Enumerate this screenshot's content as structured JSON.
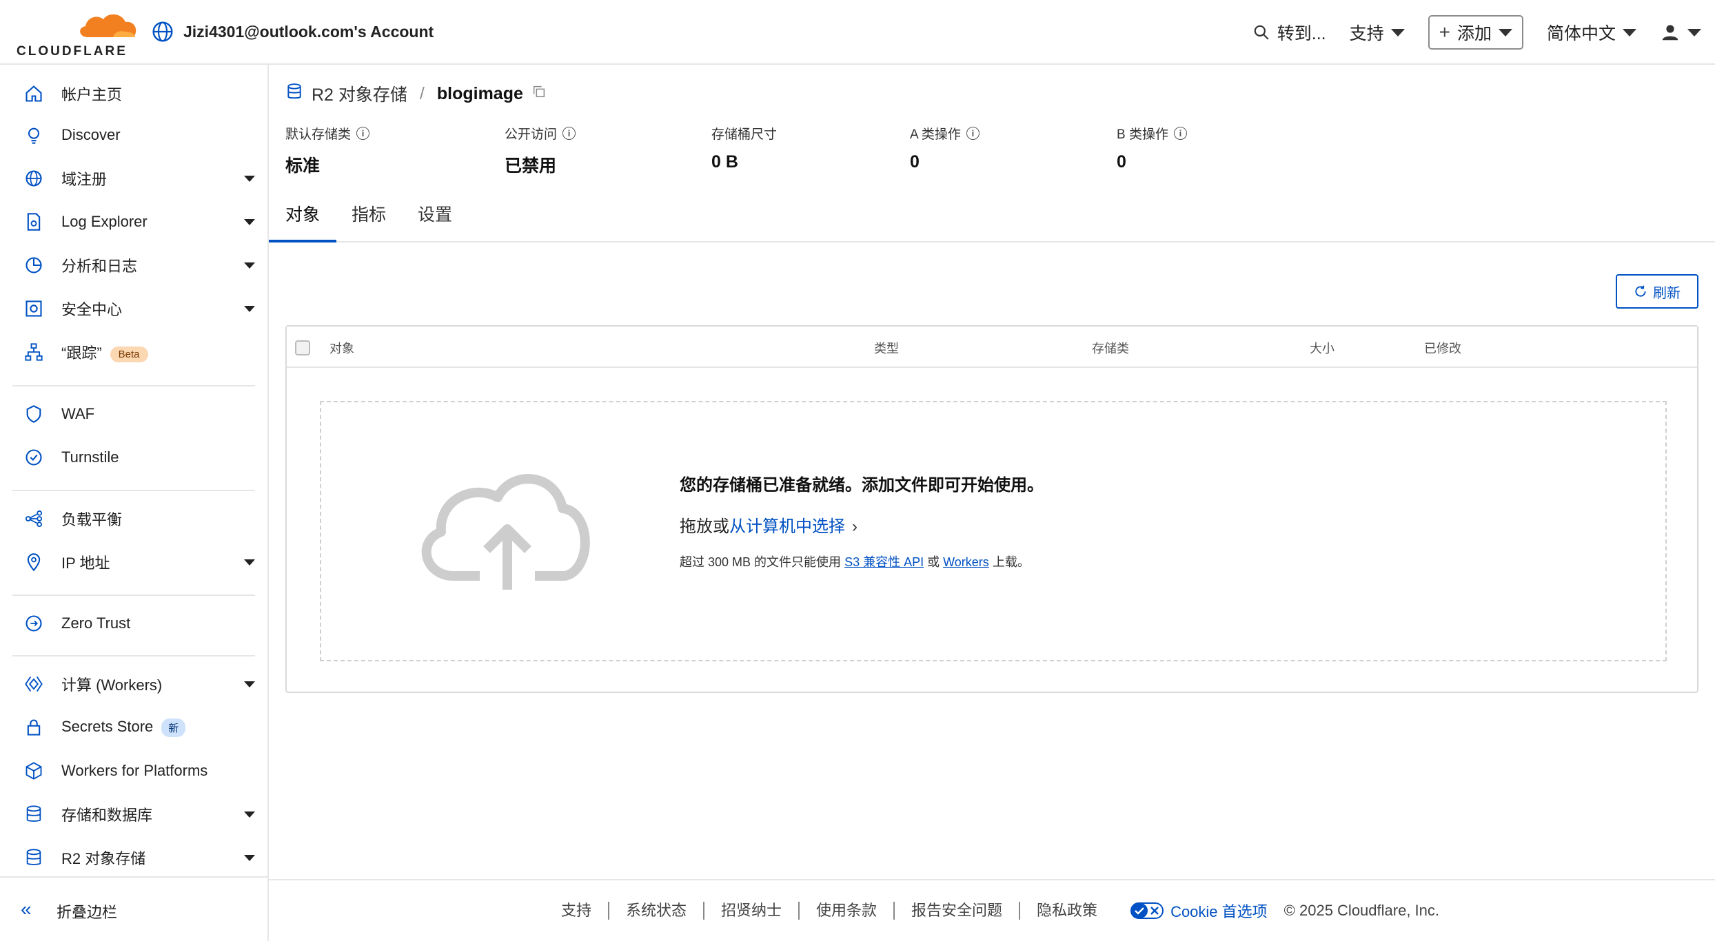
{
  "header": {
    "brand": "CLOUDFLARE",
    "account": "Jizi4301@outlook.com's Account",
    "search_label": "转到...",
    "support_label": "支持",
    "add_label": "添加",
    "language_label": "简体中文"
  },
  "sidebar": {
    "items": [
      {
        "label": "帐户主页"
      },
      {
        "label": "Discover"
      },
      {
        "label": "域注册"
      },
      {
        "label": "Log Explorer"
      },
      {
        "label": "分析和日志"
      },
      {
        "label": "安全中心"
      },
      {
        "label": "“跟踪”",
        "badge": "Beta"
      },
      {
        "label": "WAF"
      },
      {
        "label": "Turnstile"
      },
      {
        "label": "负载平衡"
      },
      {
        "label": "IP 地址"
      },
      {
        "label": "Zero Trust"
      },
      {
        "label": "计算 (Workers)"
      },
      {
        "label": "Secrets Store",
        "badge": "新"
      },
      {
        "label": "Workers for Platforms"
      },
      {
        "label": "存储和数据库"
      },
      {
        "label": "R2 对象存储"
      }
    ],
    "collapse_label": "折叠边栏"
  },
  "breadcrumb": {
    "parent": "R2 对象存储",
    "current": "blogimage"
  },
  "stats": [
    {
      "key": "默认存储类",
      "value": "标准"
    },
    {
      "key": "公开访问",
      "value": "已禁用"
    },
    {
      "key": "存储桶尺寸",
      "value": "0 B"
    },
    {
      "key": "A 类操作",
      "value": "0"
    },
    {
      "key": "B 类操作",
      "value": "0"
    }
  ],
  "tabs": [
    "对象",
    "指标",
    "设置"
  ],
  "refresh_label": "刷新",
  "table": {
    "columns": [
      "对象",
      "类型",
      "存储类",
      "大小",
      "已修改"
    ]
  },
  "empty_state": {
    "title": "您的存储桶已准备就绪。添加文件即可开始使用。",
    "drag_text": "拖放或",
    "choose_link": "从计算机中选择",
    "note_prefix": "超过 300 MB 的文件只能使用",
    "s3_link": "S3 兼容性 API",
    "or": "或",
    "workers_link": "Workers",
    "note_suffix": "上载。"
  },
  "footer": {
    "links": [
      "支持",
      "系统状态",
      "招贤纳士",
      "使用条款",
      "报告安全问题",
      "隐私政策"
    ],
    "cookie_label": "Cookie 首选项",
    "copyright": "© 2025 Cloudflare, Inc."
  },
  "colors": {
    "accent": "#0051c3",
    "brand_orange": "#f38020"
  }
}
